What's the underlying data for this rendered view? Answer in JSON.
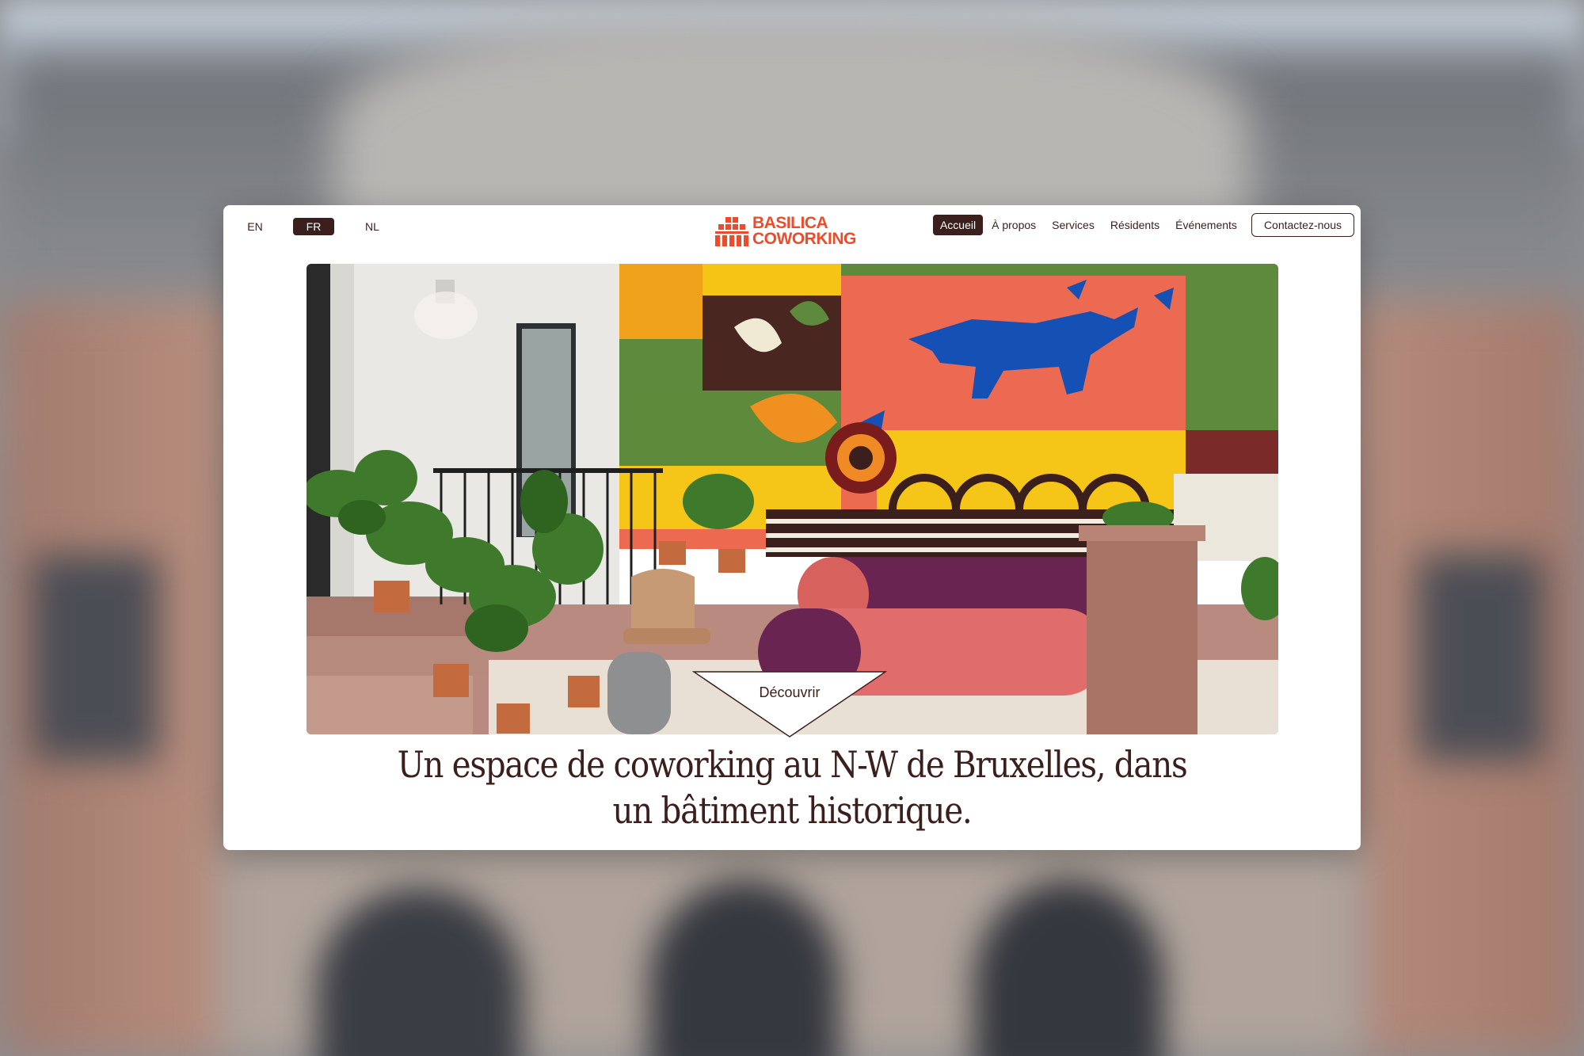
{
  "languages": {
    "items": [
      "EN",
      "FR",
      "NL"
    ],
    "active": "FR"
  },
  "logo": {
    "line1": "BASILICA",
    "line2": "COWORKING",
    "color": "#ec4c2b"
  },
  "nav": {
    "items": [
      "Accueil",
      "À propos",
      "Services",
      "Résidents",
      "Événements"
    ],
    "active": "Accueil",
    "contact": "Contactez-nous"
  },
  "hero": {
    "cta": "Découvrir",
    "icon": "down-arrow-triangle-icon"
  },
  "headline": {
    "line1": "Un espace de coworking au N-W de Bruxelles, dans",
    "line2": "un bâtiment historique."
  },
  "colors": {
    "brown": "#3b1f1c",
    "accent": "#ec4c2b"
  }
}
